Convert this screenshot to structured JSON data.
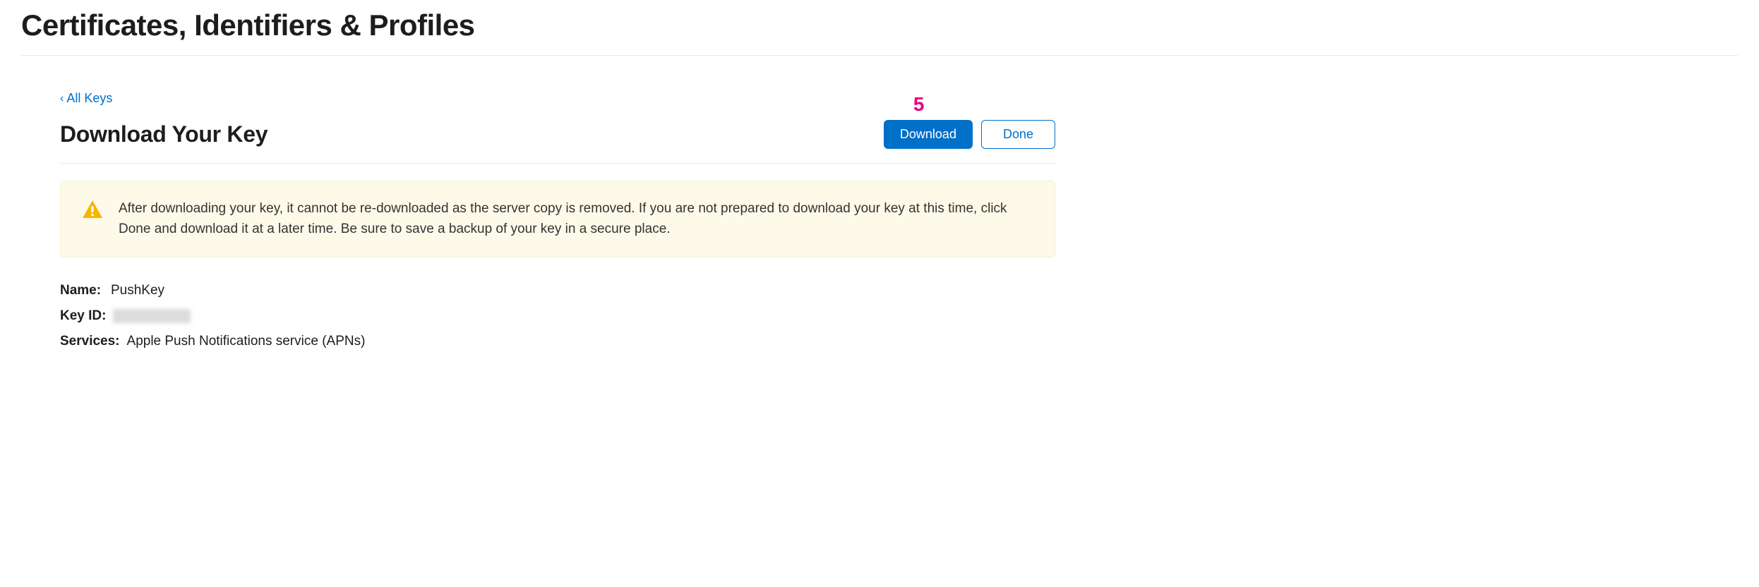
{
  "page": {
    "title": "Certificates, Identifiers & Profiles"
  },
  "navigation": {
    "back_label": "All Keys"
  },
  "section": {
    "title": "Download Your Key"
  },
  "actions": {
    "download_label": "Download",
    "done_label": "Done"
  },
  "annotation": {
    "step_number": "5"
  },
  "warning": {
    "message": "After downloading your key, it cannot be re-downloaded as the server copy is removed. If you are not prepared to download your key at this time, click Done and download it at a later time. Be sure to save a backup of your key in a secure place."
  },
  "details": {
    "name_label": "Name:",
    "name_value": "PushKey",
    "keyid_label": "Key ID:",
    "keyid_value": "",
    "services_label": "Services:",
    "services_value": "Apple Push Notifications service (APNs)"
  }
}
